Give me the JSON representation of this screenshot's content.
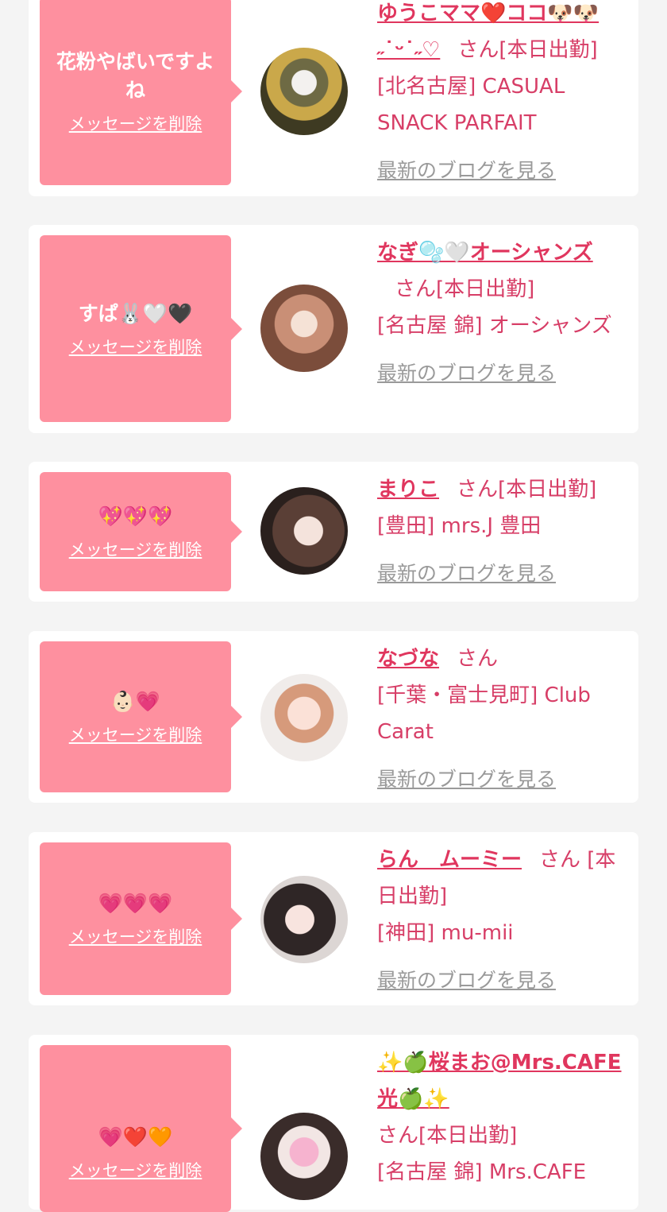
{
  "colors": {
    "bubble": "#fe909f",
    "accent": "#e0365e",
    "text": "#d73e67",
    "muted": "#9a9a9a",
    "background": "#f4f4f4"
  },
  "items": [
    {
      "message": "花粉やばいですよね",
      "delete_label": "メッセージを削除",
      "name": "ゆうこママ❤️ココ🐶🐶˶˙ᵕ˙˶♡",
      "suffix": "さん[本日出勤]",
      "store": "[北名古屋] CASUAL SNACK PARFAIT",
      "blog_label": "最新のブログを見る"
    },
    {
      "message": "すぱ🐰🤍🖤",
      "delete_label": "メッセージを削除",
      "name": "なぎ🫧🤍オーシャンズ",
      "suffix": "さん[本日出勤]",
      "store": "[名古屋 錦] オーシャンズ",
      "blog_label": "最新のブログを見る"
    },
    {
      "message": "💖💖💖",
      "delete_label": "メッセージを削除",
      "name": "まりこ",
      "suffix": "さん[本日出勤]",
      "store": "[豊田] mrs.J 豊田",
      "blog_label": "最新のブログを見る"
    },
    {
      "message": "👶🏻💗",
      "delete_label": "メッセージを削除",
      "name": "なづな",
      "suffix": "さん",
      "store": "[千葉・富士見町] Club Carat",
      "blog_label": "最新のブログを見る"
    },
    {
      "message": "💗💗💗",
      "delete_label": "メッセージを削除",
      "name": "らん　ムーミー",
      "suffix": "さん [本日出勤]",
      "store": "[神田] mu-mii",
      "blog_label": "最新のブログを見る"
    },
    {
      "message": "💗❤️🧡",
      "delete_label": "メッセージを削除",
      "name": "✨🍏桜まお@Mrs.CAFE光🍏✨",
      "suffix": "さん[本日出勤]",
      "store": "[名古屋 錦] Mrs.CAFE",
      "blog_label": ""
    }
  ]
}
